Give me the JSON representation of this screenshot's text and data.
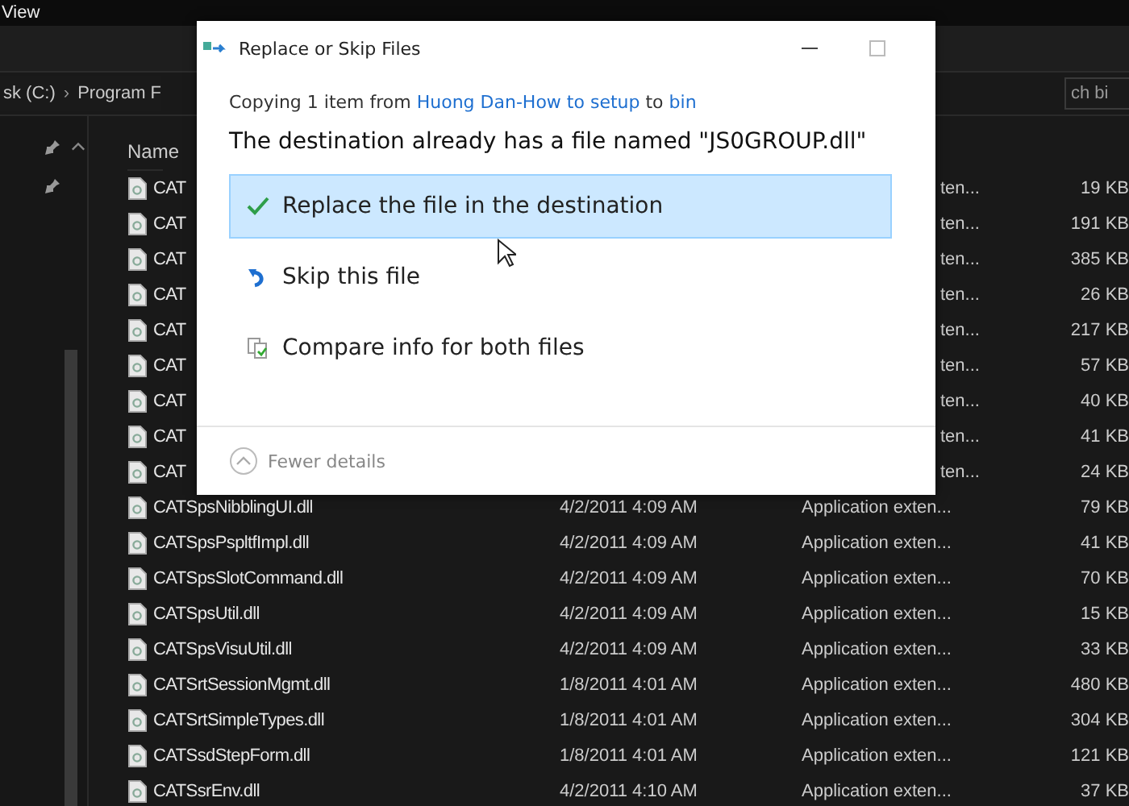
{
  "menu": {
    "label": "View"
  },
  "breadcrumb": [
    "sk (C:)",
    "›",
    "Program F"
  ],
  "search": {
    "value": "ch bi"
  },
  "header": {
    "name": "Name"
  },
  "files": [
    {
      "name": "CAT",
      "type": "ten...",
      "size": "19 KB"
    },
    {
      "name": "CAT",
      "type": "ten...",
      "size": "191 KB"
    },
    {
      "name": "CAT",
      "type": "ten...",
      "size": "385 KB"
    },
    {
      "name": "CAT",
      "type": "ten...",
      "size": "26 KB"
    },
    {
      "name": "CAT",
      "type": "ten...",
      "size": "217 KB"
    },
    {
      "name": "CAT",
      "type": "ten...",
      "size": "57 KB"
    },
    {
      "name": "CAT",
      "type": "ten...",
      "size": "40 KB"
    },
    {
      "name": "CAT",
      "type": "ten...",
      "size": "41 KB"
    },
    {
      "name": "CAT",
      "type": "ten...",
      "size": "24 KB"
    },
    {
      "name": "CATSpsNibblingUI.dll",
      "date": "4/2/2011 4:09 AM",
      "type": "Application exten...",
      "size": "79 KB"
    },
    {
      "name": "CATSpsPspltfImpl.dll",
      "date": "4/2/2011 4:09 AM",
      "type": "Application exten...",
      "size": "41 KB"
    },
    {
      "name": "CATSpsSlotCommand.dll",
      "date": "4/2/2011 4:09 AM",
      "type": "Application exten...",
      "size": "70 KB"
    },
    {
      "name": "CATSpsUtil.dll",
      "date": "4/2/2011 4:09 AM",
      "type": "Application exten...",
      "size": "15 KB"
    },
    {
      "name": "CATSpsVisuUtil.dll",
      "date": "4/2/2011 4:09 AM",
      "type": "Application exten...",
      "size": "33 KB"
    },
    {
      "name": "CATSrtSessionMgmt.dll",
      "date": "1/8/2011 4:01 AM",
      "type": "Application exten...",
      "size": "480 KB"
    },
    {
      "name": "CATSrtSimpleTypes.dll",
      "date": "1/8/2011 4:01 AM",
      "type": "Application exten...",
      "size": "304 KB"
    },
    {
      "name": "CATSsdStepForm.dll",
      "date": "1/8/2011 4:01 AM",
      "type": "Application exten...",
      "size": "121 KB"
    },
    {
      "name": "CATSsrEnv.dll",
      "date": "4/2/2011 4:10 AM",
      "type": "Application exten...",
      "size": "37 KB"
    }
  ],
  "dialog": {
    "title": "Replace or Skip Files",
    "copying": {
      "prefix": "Copying 1 item from",
      "source": "Huong Dan-How to setup",
      "middle": "to",
      "target": "bin"
    },
    "message": "The destination already has a file named \"JS0GROUP.dll\"",
    "options": [
      {
        "kind": "replace",
        "label": "Replace the file in the destination",
        "selected": true
      },
      {
        "kind": "skip",
        "label": "Skip this file",
        "selected": false
      },
      {
        "kind": "compare",
        "label": "Compare info for both files",
        "selected": false
      }
    ],
    "details": {
      "label": "Fewer details"
    }
  }
}
